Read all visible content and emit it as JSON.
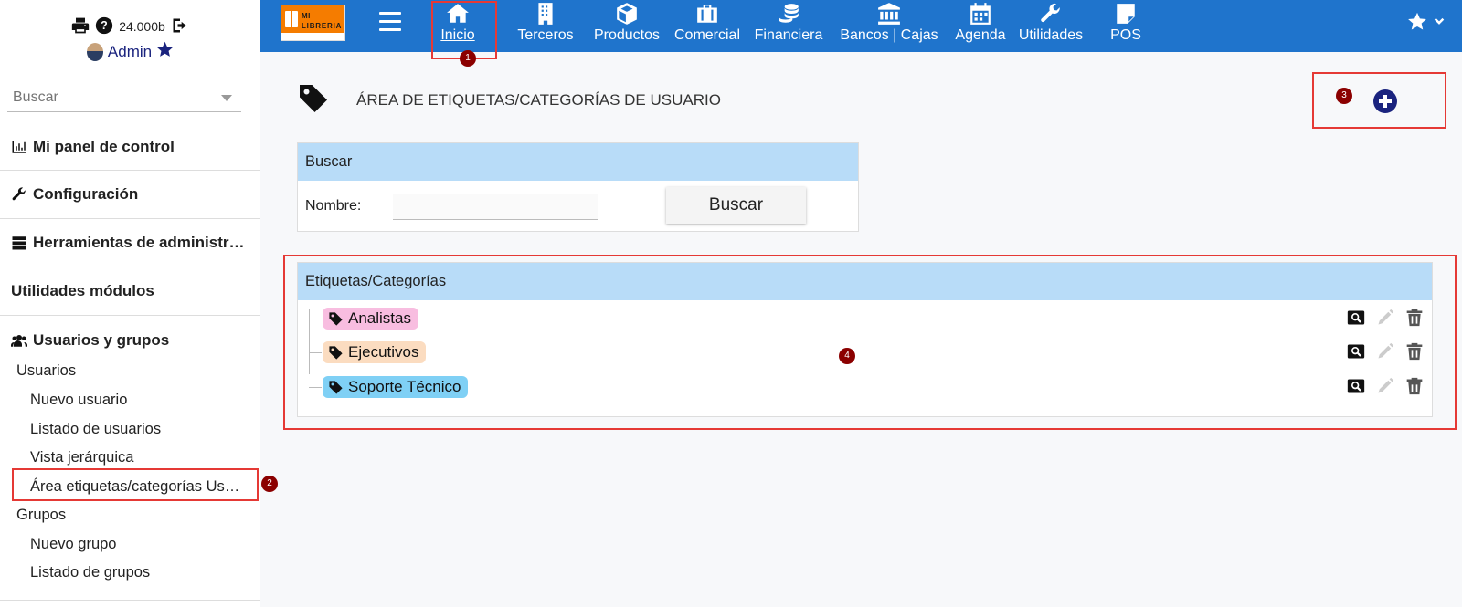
{
  "sidebar": {
    "balance": "24.000b",
    "user_name": "Admin",
    "search_placeholder": "Buscar",
    "sections": {
      "panel": "Mi panel de control",
      "config": "Configuración",
      "tools": "Herramientas de administr…",
      "utilities": "Utilidades módulos",
      "users_groups": "Usuarios y grupos"
    },
    "links": {
      "usuarios": "Usuarios",
      "nuevo_usuario": "Nuevo usuario",
      "listado_usuarios": "Listado de usuarios",
      "vista_jerarquica": "Vista jerárquica",
      "area_etiquetas": "Área etiquetas/categorías Us…",
      "grupos": "Grupos",
      "nuevo_grupo": "Nuevo grupo",
      "listado_grupos": "Listado de grupos"
    }
  },
  "topbar": {
    "logo_text_1": "MI",
    "logo_text_2": "LIBRERIA",
    "nav": {
      "inicio": "Inicio",
      "terceros": "Terceros",
      "productos": "Productos",
      "comercial": "Comercial",
      "financiera": "Financiera",
      "bancos": "Bancos | Cajas",
      "agenda": "Agenda",
      "utilidades": "Utilidades",
      "pos": "POS"
    }
  },
  "main": {
    "title": "ÁREA DE ETIQUETAS/CATEGORÍAS DE USUARIO",
    "search_panel": {
      "heading": "Buscar",
      "name_label": "Nombre:",
      "search_button": "Buscar"
    },
    "tags_panel": {
      "heading": "Etiquetas/Categorías",
      "tags": [
        {
          "label": "Analistas",
          "color": "#f8bde0"
        },
        {
          "label": "Ejecutivos",
          "color": "#fbdcc0"
        },
        {
          "label": "Soporte Técnico",
          "color": "#7fd0f5"
        }
      ]
    }
  },
  "annotations": [
    "1",
    "2",
    "3",
    "4"
  ],
  "colors": {
    "topbar": "#1f74cc",
    "panel_header": "#b8dcf8",
    "add_button": "#1a237e",
    "annotation_border": "#e53935",
    "annotation_badge": "#8b0000"
  }
}
